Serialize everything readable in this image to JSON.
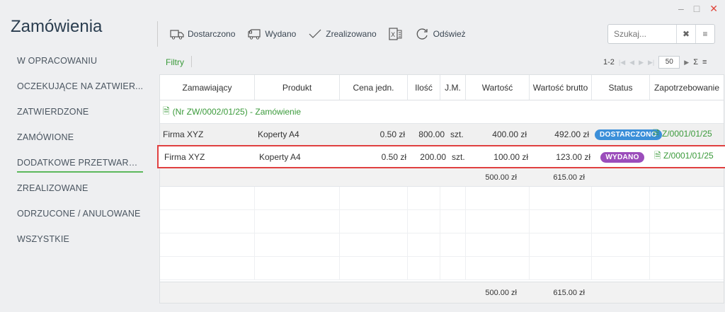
{
  "window": {
    "minimize": "–",
    "maximize": "□",
    "close": "✕"
  },
  "title": "Zamówienia",
  "sidebar": {
    "items": [
      {
        "label": "W OPRACOWANIU"
      },
      {
        "label": "OCZEKUJĄCE NA ZATWIER..."
      },
      {
        "label": "ZATWIERDZONE"
      },
      {
        "label": "ZAMÓWIONE"
      },
      {
        "label": "DODATKOWE PRZETWARZA..."
      },
      {
        "label": "ZREALIZOWANE"
      },
      {
        "label": "ODRZUCONE / ANULOWANE"
      },
      {
        "label": "WSZYSTKIE"
      }
    ],
    "active_index": 4
  },
  "toolbar": {
    "delivered": "Dostarczono",
    "issued": "Wydano",
    "completed": "Zrealizowano",
    "refresh": "Odśwież"
  },
  "search": {
    "placeholder": "Szukaj..."
  },
  "filters_label": "Filtry",
  "pager": {
    "range": "1-2",
    "page_size": "50"
  },
  "columns": [
    "Zamawiający",
    "Produkt",
    "Cena jedn.",
    "Ilość",
    "J.M.",
    "Wartość",
    "Wartość brutto",
    "Status",
    "Zapotrzebowanie"
  ],
  "group": {
    "label": "(Nr ZW/0002/01/25) - Zamówienie"
  },
  "rows": [
    {
      "client": "Firma XYZ",
      "product": "Koperty A4",
      "price": "0.50 zł",
      "qty": "800.00",
      "unit": "szt.",
      "value": "400.00 zł",
      "gross": "492.00 zł",
      "status": "DOSTARCZONO",
      "status_color": "#3b8fd9",
      "req": "Z/0001/01/25"
    },
    {
      "client": "Firma XYZ",
      "product": "Koperty A4",
      "price": "0.50 zł",
      "qty": "200.00",
      "unit": "szt.",
      "value": "100.00 zł",
      "gross": "123.00 zł",
      "status": "WYDANO",
      "status_color": "#9b4dbb",
      "req": "Z/0001/01/25"
    }
  ],
  "group_total": {
    "value": "500.00 zł",
    "gross": "615.00 zł"
  },
  "grand_total": {
    "value": "500.00 zł",
    "gross": "615.00 zł"
  },
  "colors": {
    "accent_green": "#3a9a3a",
    "highlight_red": "#e04040"
  }
}
